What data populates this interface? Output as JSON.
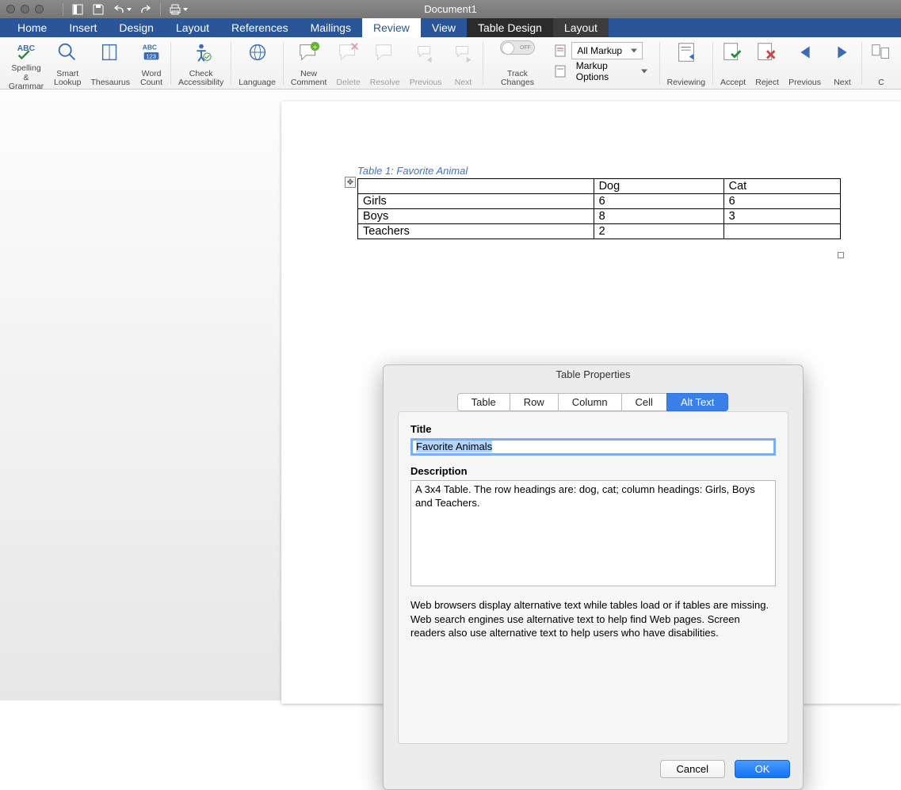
{
  "titlebar": {
    "document_title": "Document1"
  },
  "menubar": {
    "tabs": [
      "Home",
      "Insert",
      "Design",
      "Layout",
      "References",
      "Mailings",
      "Review",
      "View",
      "Table Design",
      "Layout"
    ],
    "active_index": 6,
    "context_indices": [
      8,
      9
    ]
  },
  "ribbon": {
    "spelling": "Spelling &\nGrammar",
    "smart_lookup": "Smart\nLookup",
    "thesaurus": "Thesaurus",
    "word_count": "Word\nCount",
    "check_access": "Check\nAccessibility",
    "language": "Language",
    "new_comment": "New\nComment",
    "delete": "Delete",
    "resolve": "Resolve",
    "previous": "Previous",
    "next": "Next",
    "track_changes": "Track Changes",
    "toggle_off": "OFF",
    "markup_select": "All Markup",
    "markup_options": "Markup Options",
    "reviewing": "Reviewing",
    "accept": "Accept",
    "reject": "Reject",
    "previous2": "Previous",
    "next2": "Next",
    "compare_initial": "C"
  },
  "document": {
    "caption": "Table 1: Favorite Animal",
    "table": {
      "headers": [
        "",
        "Dog",
        "Cat"
      ],
      "rows": [
        [
          "Girls",
          "6",
          "6"
        ],
        [
          "Boys",
          "8",
          "3"
        ],
        [
          "Teachers",
          "2",
          ""
        ]
      ]
    }
  },
  "dialog": {
    "title": "Table Properties",
    "tabs": [
      "Table",
      "Row",
      "Column",
      "Cell",
      "Alt Text"
    ],
    "active_tab": 4,
    "field_title_label": "Title",
    "field_title_value": "Favorite Animals",
    "field_desc_label": "Description",
    "field_desc_value": "A 3x4 Table. The row headings are: dog, cat; column headings: Girls, Boys and Teachers.",
    "help_text": "Web browsers display alternative text while tables load or if tables are missing. Web search engines use alternative text to help find Web pages. Screen readers also use alternative text to help users who have disabilities.",
    "cancel": "Cancel",
    "ok": "OK"
  }
}
